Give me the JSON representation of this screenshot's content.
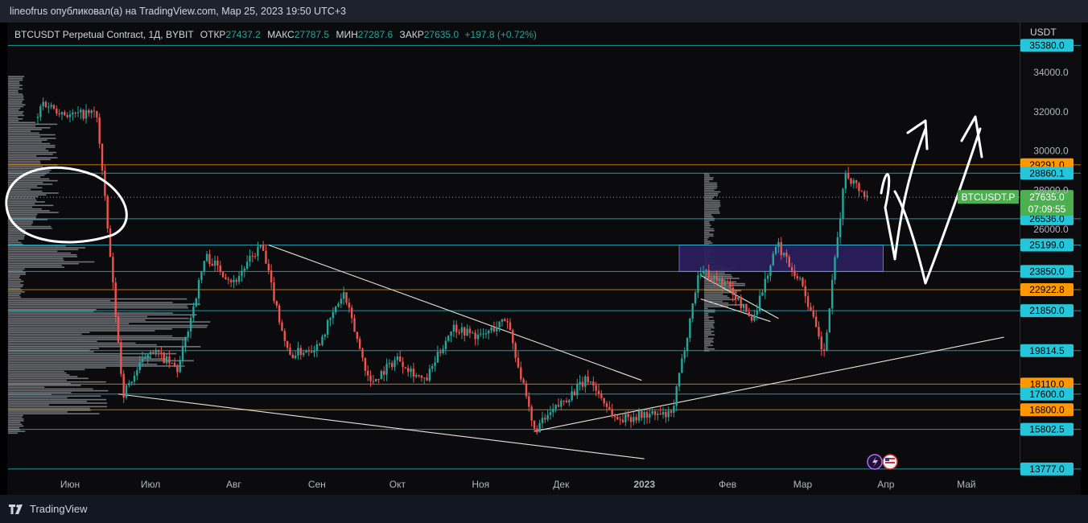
{
  "header": {
    "publisher_line": "lineofrus опубликовал(а) на TradingView.com, Мар 25, 2023 19:50 UTC+3"
  },
  "legend": {
    "symbol": "BTCUSDT Perpetual Contract, 1Д, BYBIT",
    "open_label": "ОТКР",
    "open_value": "27437.2",
    "high_label": "МАКС",
    "high_value": "27787.5",
    "low_label": "МИН",
    "low_value": "27287.6",
    "close_label": "ЗАКР",
    "close_value": "27635.0",
    "change": "+197.8 (+0.72%)"
  },
  "price_axis": {
    "currency": "USDT",
    "symbol_tag": "BTCUSDT.P",
    "countdown": "07:09:55"
  },
  "footer": {
    "brand": "TradingView"
  },
  "colors": {
    "background": "#0b0b0d",
    "up": "#26a69a",
    "down": "#ef5350",
    "cyan_level": "#26c6da",
    "orange_level": "#ff9800",
    "box_fill": "#2a1f5c",
    "label_green": "#4caf50"
  },
  "chart_data": {
    "type": "candlestick",
    "title": "BTCUSDT Perpetual Contract, 1Д, BYBIT",
    "ylim": [
      12800,
      36000
    ],
    "y_ticks": [
      {
        "price": 34000,
        "label": "34000.0"
      },
      {
        "price": 32000,
        "label": "32000.0"
      },
      {
        "price": 30000,
        "label": "30000.0"
      },
      {
        "price": 28000,
        "label": "28000.0"
      },
      {
        "price": 26000,
        "label": "26000.0"
      }
    ],
    "x_ticks": [
      {
        "date": "2022-06-01",
        "label": "Июн"
      },
      {
        "date": "2022-07-01",
        "label": "Июл"
      },
      {
        "date": "2022-08-01",
        "label": "Авг"
      },
      {
        "date": "2022-09-01",
        "label": "Сен"
      },
      {
        "date": "2022-10-01",
        "label": "Окт"
      },
      {
        "date": "2022-11-01",
        "label": "Ноя"
      },
      {
        "date": "2022-12-01",
        "label": "Дек"
      },
      {
        "date": "2023-01-01",
        "label": "2023"
      },
      {
        "date": "2023-02-01",
        "label": "Фев"
      },
      {
        "date": "2023-03-01",
        "label": "Мар"
      },
      {
        "date": "2023-04-01",
        "label": "Апр"
      },
      {
        "date": "2023-05-01",
        "label": "Май"
      }
    ],
    "horizontal_levels": [
      {
        "price": 35380,
        "label": "35380.0",
        "color": "cyan"
      },
      {
        "price": 29291,
        "label": "29291.0",
        "color": "orange"
      },
      {
        "price": 28860.1,
        "label": "28860.1",
        "color": "cyan"
      },
      {
        "price": 26536,
        "label": "26536.0",
        "color": "cyan"
      },
      {
        "price": 25199,
        "label": "25199.0",
        "color": "cyan"
      },
      {
        "price": 23850,
        "label": "23850.0",
        "color": "cyan"
      },
      {
        "price": 22922.8,
        "label": "22922.8",
        "color": "orange"
      },
      {
        "price": 21850,
        "label": "21850.0",
        "color": "cyan"
      },
      {
        "price": 19814.5,
        "label": "19814.5",
        "color": "cyan"
      },
      {
        "price": 18110,
        "label": "18110.0",
        "color": "orange"
      },
      {
        "price": 17600,
        "label": "17600.0",
        "color": "cyan"
      },
      {
        "price": 16800,
        "label": "16800.0",
        "color": "orange"
      },
      {
        "price": 15802.5,
        "label": "15802.5",
        "color": "cyan"
      },
      {
        "price": 13777,
        "label": "13777.0",
        "color": "cyan"
      }
    ],
    "last_price": {
      "price": 27635.0,
      "label": "27635.0"
    },
    "zone": {
      "from": "2023-01-14",
      "to": "2023-03-31",
      "low": 23850,
      "high": 25199
    },
    "trendlines": [
      {
        "from": [
          "2022-08-14",
          25199
        ],
        "to": [
          "2022-12-31",
          18300
        ]
      },
      {
        "from": [
          "2022-06-19",
          17600
        ],
        "to": [
          "2023-01-01",
          14300
        ]
      },
      {
        "from": [
          "2022-11-21",
          15700
        ],
        "to": [
          "2023-05-15",
          20500
        ]
      },
      {
        "from": [
          "2023-01-22",
          23650
        ],
        "to": [
          "2023-02-20",
          21450
        ]
      },
      {
        "from": [
          "2023-01-22",
          22450
        ],
        "to": [
          "2023-02-17",
          21300
        ]
      }
    ],
    "candles_monthly_ohlc": [
      {
        "month": "2022-05",
        "open": 29700,
        "high": 32500,
        "low": 26700,
        "close": 31800
      },
      {
        "month": "2022-06",
        "open": 31800,
        "high": 31950,
        "low": 17600,
        "close": 19950
      },
      {
        "month": "2022-07",
        "open": 19950,
        "high": 24650,
        "low": 18800,
        "close": 23300
      },
      {
        "month": "2022-08",
        "open": 23300,
        "high": 25199,
        "low": 19550,
        "close": 20050
      },
      {
        "month": "2022-09",
        "open": 20050,
        "high": 22750,
        "low": 18150,
        "close": 19450
      },
      {
        "month": "2022-10",
        "open": 19450,
        "high": 21050,
        "low": 18200,
        "close": 20500
      },
      {
        "month": "2022-11",
        "open": 20500,
        "high": 21450,
        "low": 15700,
        "close": 17150
      },
      {
        "month": "2022-12",
        "open": 17150,
        "high": 18400,
        "low": 16300,
        "close": 16550
      },
      {
        "month": "2023-01",
        "open": 16550,
        "high": 23950,
        "low": 16500,
        "close": 23150
      },
      {
        "month": "2023-02",
        "open": 23150,
        "high": 25250,
        "low": 21350,
        "close": 23150
      },
      {
        "month": "2023-03",
        "open": 23150,
        "high": 28900,
        "low": 19550,
        "close": 27635
      }
    ]
  }
}
